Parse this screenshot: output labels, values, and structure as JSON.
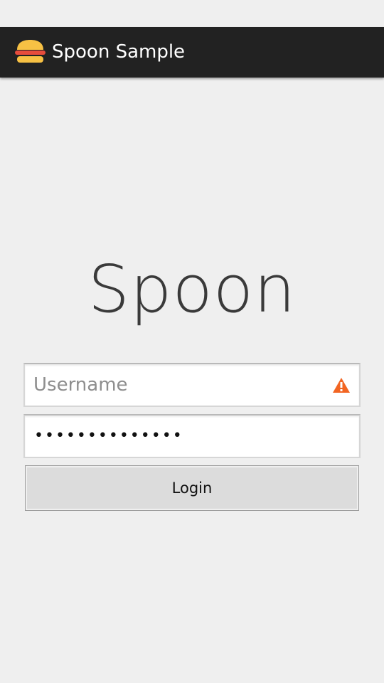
{
  "action_bar": {
    "title": "Spoon Sample",
    "icon": "burger-icon",
    "background": "#222222"
  },
  "logo": {
    "text": "Spoon"
  },
  "form": {
    "username": {
      "placeholder": "Username",
      "value": "",
      "error_icon": "warning-icon",
      "error_color": "#f26522"
    },
    "password": {
      "masked_value": "••••••••••••••",
      "length": 14
    },
    "login_label": "Login"
  }
}
